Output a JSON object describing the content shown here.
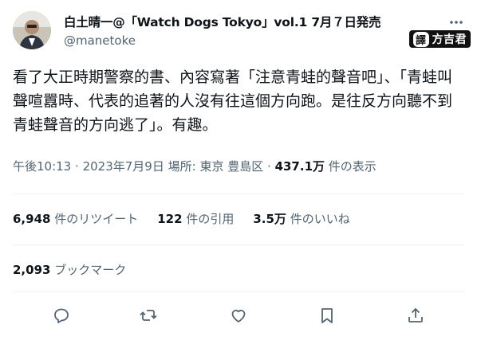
{
  "user": {
    "display_name": "白土晴一@「Watch Dogs Tokyo」vol.1 7月７日発売",
    "handle": "@manetoke"
  },
  "watermark": {
    "prefix": "譯",
    "text": "方吉君"
  },
  "tweet": {
    "text": "看了大正時期警察的書、內容寫著「注意青蛙的聲音吧」、「青蛙叫聲喧囂時、代表的追著的人沒有往這個方向跑。是往反方向聽不到青蛙聲音的方向逃了」。有趣。"
  },
  "meta": {
    "time": "午後10:13",
    "separator": "·",
    "date": "2023年7月9日",
    "location": "場所: 東京 豊島区",
    "views_count": "437.1万",
    "views_label": "件の表示"
  },
  "stats": {
    "retweets_count": "6,948",
    "retweets_label": "件のリツイート",
    "quotes_count": "122",
    "quotes_label": "件の引用",
    "likes_count": "3.5万",
    "likes_label": "件のいいね"
  },
  "bookmarks": {
    "count": "2,093",
    "label": "ブックマーク"
  },
  "actions": [
    {
      "name": "reply-icon"
    },
    {
      "name": "retweet-icon"
    },
    {
      "name": "like-icon"
    },
    {
      "name": "bookmark-icon"
    },
    {
      "name": "share-icon"
    }
  ]
}
